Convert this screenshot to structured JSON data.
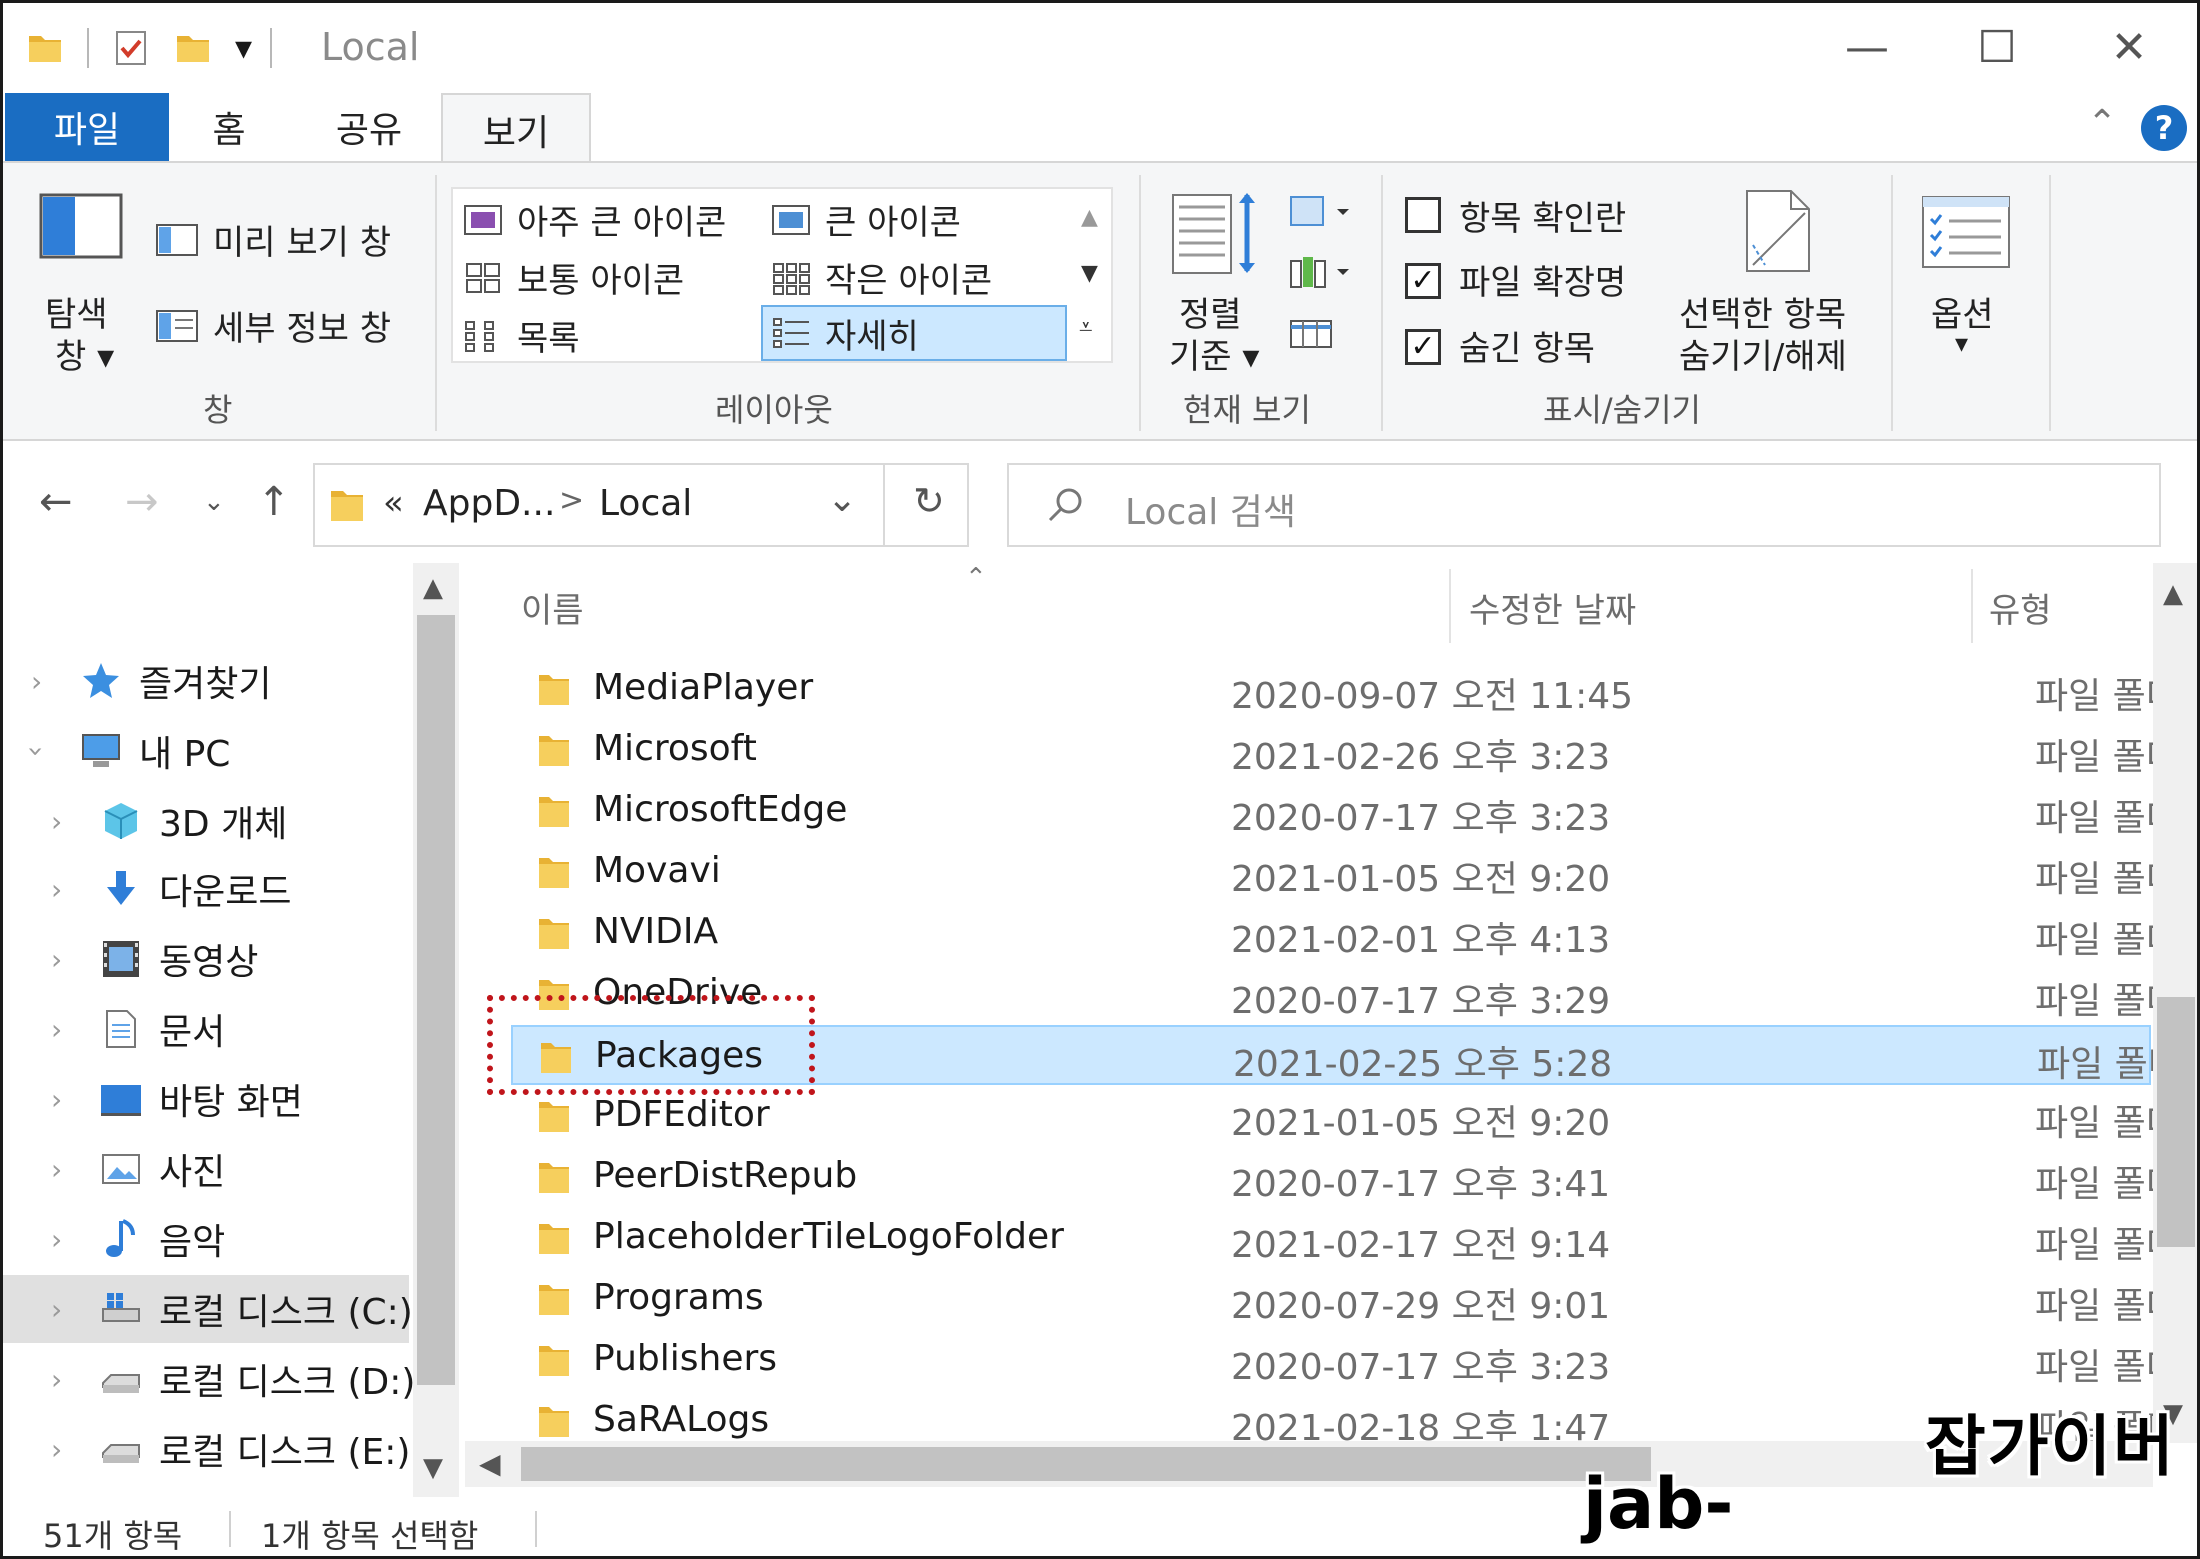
{
  "window": {
    "title": "Local",
    "controls": {
      "minimize": "—",
      "maximize": "☐",
      "close": "✕"
    }
  },
  "ribbon": {
    "tabs": [
      "파일",
      "홈",
      "공유",
      "보기"
    ],
    "active_tab": "보기",
    "collapse_glyph": "⌃",
    "help_glyph": "?",
    "panes": {
      "nav_pane": [
        "탐색",
        "창 ▾"
      ],
      "preview_pane": "미리 보기 창",
      "details_pane": "세부 정보 창",
      "group_label": "창"
    },
    "layout": {
      "items": [
        "아주 큰 아이콘",
        "큰 아이콘",
        "보통 아이콘",
        "작은 아이콘",
        "목록",
        "자세히"
      ],
      "selected": "자세히",
      "group_label": "레이아웃"
    },
    "current_view": {
      "sort_by": [
        "정렬",
        "기준 ▾"
      ],
      "group_label": "현재 보기"
    },
    "show_hide": {
      "checkboxes": [
        {
          "label": "항목 확인란",
          "checked": false
        },
        {
          "label": "파일 확장명",
          "checked": true
        },
        {
          "label": "숨긴 항목",
          "checked": true
        }
      ],
      "hide_selected": [
        "선택한 항목",
        "숨기기/해제"
      ],
      "group_label": "표시/숨기기"
    },
    "options": [
      "옵션",
      "▾"
    ]
  },
  "address_bar": {
    "breadcrumb": [
      "«",
      "AppD...",
      ">",
      "Local"
    ],
    "search_placeholder": "Local 검색"
  },
  "nav_pane": {
    "items": [
      {
        "label": "즐겨찾기",
        "icon": "star-icon"
      },
      {
        "label": "내 PC",
        "icon": "pc-icon"
      },
      {
        "label": "3D 개체",
        "icon": "cube-icon"
      },
      {
        "label": "다운로드",
        "icon": "download-icon"
      },
      {
        "label": "동영상",
        "icon": "video-icon"
      },
      {
        "label": "문서",
        "icon": "document-icon"
      },
      {
        "label": "바탕 화면",
        "icon": "desktop-icon"
      },
      {
        "label": "사진",
        "icon": "picture-icon"
      },
      {
        "label": "음악",
        "icon": "music-icon"
      },
      {
        "label": "로컬 디스크 (C:)",
        "icon": "disk-icon"
      },
      {
        "label": "로컬 디스크 (D:)",
        "icon": "disk-icon"
      },
      {
        "label": "로컬 디스크 (E:)",
        "icon": "disk-icon"
      }
    ],
    "selected": "로컬 디스크 (C:)"
  },
  "file_list": {
    "columns": [
      "이름",
      "수정한 날짜",
      "유형"
    ],
    "rows": [
      {
        "name": "MediaPlayer",
        "date": "2020-09-07 오전 11:45",
        "type": "파일 폴더"
      },
      {
        "name": "Microsoft",
        "date": "2021-02-26 오후 3:23",
        "type": "파일 폴더"
      },
      {
        "name": "MicrosoftEdge",
        "date": "2020-07-17 오후 3:23",
        "type": "파일 폴더"
      },
      {
        "name": "Movavi",
        "date": "2021-01-05 오전 9:20",
        "type": "파일 폴더"
      },
      {
        "name": "NVIDIA",
        "date": "2021-02-01 오후 4:13",
        "type": "파일 폴더"
      },
      {
        "name": "OneDrive",
        "date": "2020-07-17 오후 3:29",
        "type": "파일 폴더"
      },
      {
        "name": "Packages",
        "date": "2021-02-25 오후 5:28",
        "type": "파일 폴더",
        "selected": true
      },
      {
        "name": "PDFEditor",
        "date": "2021-01-05 오전 9:20",
        "type": "파일 폴더"
      },
      {
        "name": "PeerDistRepub",
        "date": "2020-07-17 오후 3:41",
        "type": "파일 폴더"
      },
      {
        "name": "PlaceholderTileLogoFolder",
        "date": "2021-02-17 오전 9:14",
        "type": "파일 폴더"
      },
      {
        "name": "Programs",
        "date": "2020-07-29 오전 9:01",
        "type": "파일 폴더"
      },
      {
        "name": "Publishers",
        "date": "2020-07-17 오후 3:23",
        "type": "파일 폴더"
      },
      {
        "name": "SaRALogs",
        "date": "2021-02-18 오후 1:47",
        "type": "파일 폴더"
      }
    ]
  },
  "status_bar": {
    "item_count": "51개 항목",
    "selected_count": "1개 항목 선택함"
  },
  "watermark": {
    "line1": "잡가이버",
    "line2": "jab-guyver.co.kr"
  },
  "colors": {
    "file_tab": "#1a6dc2",
    "selection": "#cce8ff",
    "highlight_box": "#c0151b",
    "folder": "#f4c44e"
  }
}
